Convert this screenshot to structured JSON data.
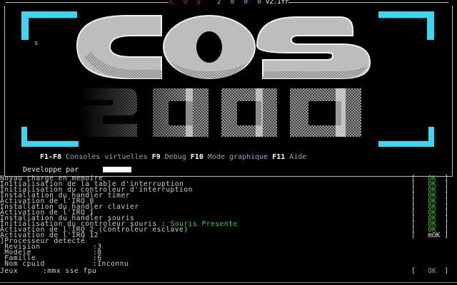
{
  "title": {
    "letters": [
      "C",
      "O",
      "S",
      "2",
      "0",
      "0",
      "0"
    ],
    "version": "v2.1fr"
  },
  "banner": {
    "side_mark": "s",
    "logo_text": "COS 2000"
  },
  "help_bar": {
    "items": [
      {
        "key": "F1-F8",
        "desc": "Consoles virtuelles"
      },
      {
        "key": "F9",
        "desc": "Debug"
      },
      {
        "key": "F10",
        "desc": "Mode graphique"
      },
      {
        "key": "F11",
        "desc": "Aide"
      }
    ],
    "developer_label": "Developpe par"
  },
  "log": {
    "lines": [
      {
        "text": "Noyau charge en memoire",
        "status": "ok"
      },
      {
        "text": "Initialisation de la table d'interruption",
        "status": "ok"
      },
      {
        "text": "Initialisation du controleur d'interruption",
        "status": "ok"
      },
      {
        "text": "Installation du handler timer",
        "status": "ok"
      },
      {
        "text": "Activation de l'IRQ 0",
        "status": "ok"
      },
      {
        "text": "Installation du handler clavier",
        "status": "ok"
      },
      {
        "text": "Activation de l'IRQ 1",
        "status": "ok"
      },
      {
        "text": "Installation du handler souris",
        "status": "ok"
      },
      {
        "text": "Initialisation du controleur souris : ",
        "extra": "Souris Presente",
        "status": "ok"
      },
      {
        "text": "Activation de l'IRQ 2 (Controleur esclave)",
        "status": "ok"
      },
      {
        "text": "Activation de l'IRQ 12",
        "status": "mok"
      }
    ],
    "ok_label": "OK",
    "mok_label": "mOK",
    "cpu_header": "Processeur detecte",
    "cpu": [
      {
        "label": " Revision",
        "value": ":3"
      },
      {
        "label": " Modele",
        "value": ":8"
      },
      {
        "label": " Famille",
        "value": ":6"
      },
      {
        "label": " Nom cpuid",
        "value": ":Inconnu"
      }
    ],
    "features_label": "Jeux",
    "features_value": ":mmx sse fpu",
    "features_status": "OK"
  },
  "colors": {
    "accent_cyan": "#38d8f0",
    "ok_green": "#30d030",
    "title_red": "#e0303a",
    "unknown_red": "#d83030"
  }
}
